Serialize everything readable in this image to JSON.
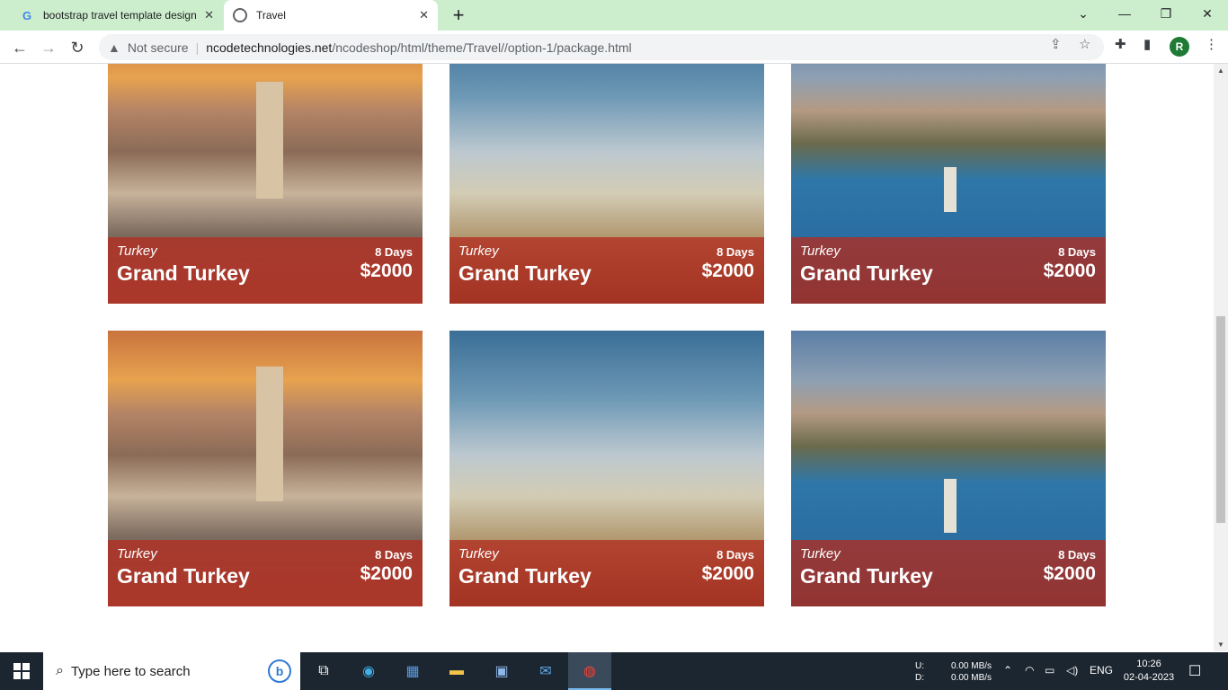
{
  "browser": {
    "tabs": [
      {
        "title": "bootstrap travel template design",
        "icon": "google-icon",
        "active": false
      },
      {
        "title": "Travel",
        "icon": "globe-icon",
        "active": true
      }
    ],
    "new_tab": "+",
    "security_label": "Not secure",
    "url_host": "ncodetechnologies.net",
    "url_path": "/ncodeshop/html/theme/Travel//option-1/package.html",
    "profile_initial": "R"
  },
  "packages": [
    {
      "country": "Turkey",
      "name": "Grand Turkey",
      "duration": "8 Days",
      "price": "$2000",
      "image": "istanbul"
    },
    {
      "country": "Turkey",
      "name": "Grand Turkey",
      "duration": "8 Days",
      "price": "$2000",
      "image": "street"
    },
    {
      "country": "Turkey",
      "name": "Grand Turkey",
      "duration": "8 Days",
      "price": "$2000",
      "image": "lake"
    },
    {
      "country": "Turkey",
      "name": "Grand Turkey",
      "duration": "8 Days",
      "price": "$2000",
      "image": "istanbul"
    },
    {
      "country": "Turkey",
      "name": "Grand Turkey",
      "duration": "8 Days",
      "price": "$2000",
      "image": "street"
    },
    {
      "country": "Turkey",
      "name": "Grand Turkey",
      "duration": "8 Days",
      "price": "$2000",
      "image": "lake"
    }
  ],
  "taskbar": {
    "search_placeholder": "Type here to search",
    "net_up_label": "U:",
    "net_down_label": "D:",
    "net_up_value": "0.00 MB/s",
    "net_down_value": "0.00 MB/s",
    "language": "ENG",
    "time": "10:26",
    "date": "02-04-2023"
  },
  "colors": {
    "tab_strip": "#cdeecd",
    "card_band": "#b22d21",
    "taskbar": "#1c2630"
  }
}
